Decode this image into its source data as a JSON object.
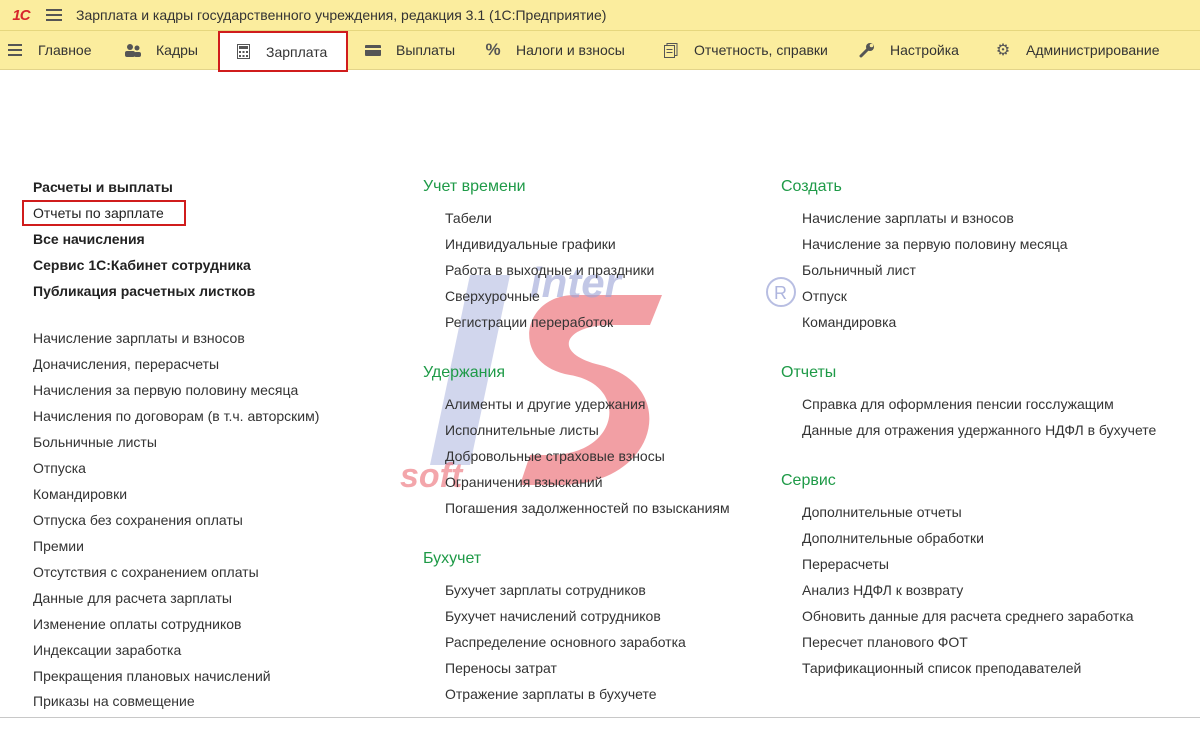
{
  "window": {
    "title": "Зарплата и кадры государственного учреждения, редакция 3.1  (1С:Предприятие)",
    "logo": "1С"
  },
  "sections": [
    {
      "label": "Главное",
      "icon": "hamburger-icon"
    },
    {
      "label": "Кадры",
      "icon": "people-icon"
    },
    {
      "label": "Зарплата",
      "icon": "calculator-icon"
    },
    {
      "label": "Выплаты",
      "icon": "card-icon"
    },
    {
      "label": "Налоги и взносы",
      "icon": "percent-icon"
    },
    {
      "label": "Отчетность, справки",
      "icon": "documents-icon"
    },
    {
      "label": "Настройка",
      "icon": "wrench-icon"
    },
    {
      "label": "Администрирование",
      "icon": "gear-icon"
    }
  ],
  "left": {
    "bold_items": [
      "Расчеты и выплаты",
      "Отчеты по зарплате",
      "Все начисления",
      "Сервис 1С:Кабинет сотрудника",
      "Публикация расчетных листков"
    ],
    "items": [
      "Начисление зарплаты и взносов",
      "Доначисления, перерасчеты",
      "Начисления за первую половину месяца",
      "Начисления по договорам (в т.ч. авторским)",
      "Больничные листы",
      "Отпуска",
      "Командировки",
      "Отпуска без сохранения оплаты",
      "Премии",
      "Отсутствия с сохранением оплаты",
      "Данные для расчета зарплаты",
      "Изменение оплаты сотрудников",
      "Индексации заработка",
      "Прекращения плановых начислений",
      "Приказы на совмещение"
    ]
  },
  "middle": {
    "groups": [
      {
        "title": "Учет времени",
        "items": [
          "Табели",
          "Индивидуальные графики",
          "Работа в выходные и праздники",
          "Сверхурочные",
          "Регистрации переработок"
        ]
      },
      {
        "title": "Удержания",
        "items": [
          "Алименты и другие удержания",
          "Исполнительные листы",
          "Добровольные страховые взносы",
          "Ограничения взысканий",
          "Погашения задолженностей по взысканиям"
        ]
      },
      {
        "title": "Бухучет",
        "items": [
          "Бухучет зарплаты сотрудников",
          "Бухучет начислений сотрудников",
          "Распределение основного заработка",
          "Переносы затрат",
          "Отражение зарплаты в бухучете"
        ]
      }
    ]
  },
  "right": {
    "groups": [
      {
        "title": "Создать",
        "items": [
          "Начисление зарплаты и взносов",
          "Начисление за первую половину месяца",
          "Больничный лист",
          "Отпуск",
          "Командировка"
        ]
      },
      {
        "title": "Отчеты",
        "items": [
          "Справка для оформления пенсии госслужащим",
          "Данные для отражения удержанного НДФЛ в бухучете"
        ]
      },
      {
        "title": "Сервис",
        "items": [
          "Дополнительные отчеты",
          "Дополнительные обработки",
          "Перерасчеты",
          "Анализ НДФЛ к возврату",
          "Обновить данные для расчета среднего заработка",
          "Пересчет планового ФОТ",
          "Тарификационный список преподавателей"
        ]
      }
    ]
  },
  "watermark": {
    "text": "inter IS soft",
    "reg": "®"
  },
  "colors": {
    "panel": "#fbed9e",
    "group_header": "#1e9a47",
    "highlight": "#d01c1c"
  }
}
